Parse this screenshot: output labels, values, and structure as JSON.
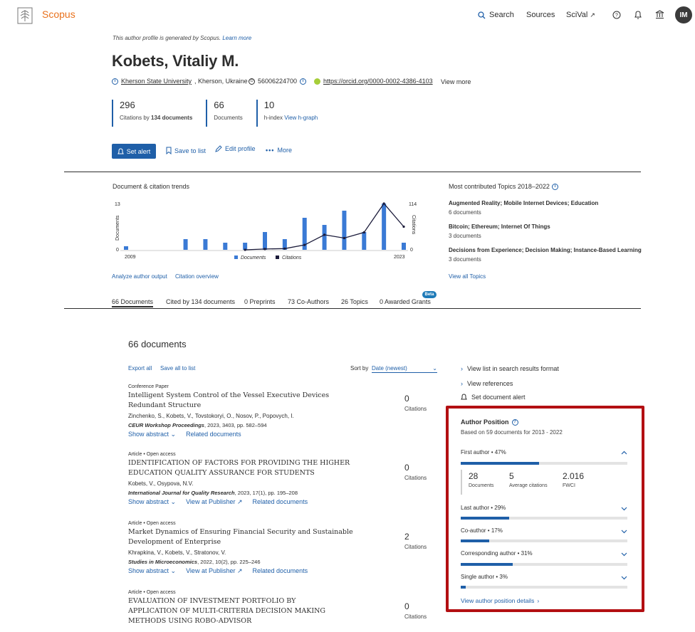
{
  "header": {
    "brand": "Scopus",
    "nav": {
      "search": "Search",
      "sources": "Sources",
      "scival": "SciVal"
    },
    "avatar_initials": "IM"
  },
  "profile": {
    "note": "This author profile is generated by Scopus.",
    "note_link": "Learn more",
    "name": "Kobets, Vitaliy M.",
    "affiliation_link": "Kherson State University",
    "affiliation_rest": ", Kherson, Ukraine",
    "author_id": "56006224700",
    "orcid": "https://orcid.org/0000-0002-4386-4103",
    "view_more": "View more"
  },
  "metrics": {
    "citations": {
      "num": "296",
      "label_pre": "Citations by ",
      "label_bold": "134 documents"
    },
    "documents": {
      "num": "66",
      "label": "Documents"
    },
    "hindex": {
      "num": "10",
      "label": "h-index ",
      "link": "View h-graph"
    }
  },
  "actions": {
    "set_alert": "Set alert",
    "save_to_list": "Save to list",
    "edit_profile": "Edit profile",
    "more": "More"
  },
  "trends": {
    "title": "Document & citation trends",
    "analyze": "Analyze author output",
    "overview": "Citation overview"
  },
  "chart_data": {
    "type": "bar",
    "x_start_label": "2009",
    "x_end_label": "2023",
    "ylabel_left": "Documents",
    "ylabel_right": "Citations",
    "ylim_left": [
      0,
      13
    ],
    "ylim_right": [
      0,
      114
    ],
    "ytick_left": [
      "13",
      "0"
    ],
    "ytick_right": [
      "114",
      "0"
    ],
    "years": [
      2009,
      2010,
      2011,
      2012,
      2013,
      2014,
      2015,
      2016,
      2017,
      2018,
      2019,
      2020,
      2021,
      2022,
      2023
    ],
    "series": [
      {
        "name": "Documents",
        "values": [
          1,
          0,
          0,
          3,
          3,
          2,
          2,
          5,
          3,
          9,
          7,
          11,
          5,
          13,
          2
        ]
      },
      {
        "name": "Citations",
        "values": [
          0,
          0,
          0,
          0,
          0,
          0,
          0,
          2,
          3,
          12,
          37,
          29,
          43,
          114,
          57
        ]
      }
    ]
  },
  "topics": {
    "title": "Most contributed Topics 2018–2022",
    "items": [
      {
        "name": "Augmented Reality; Mobile Internet Devices; Education",
        "count": "6 documents"
      },
      {
        "name": "Bitcoin; Ethereum; Internet Of Things",
        "count": "3 documents"
      },
      {
        "name": "Decisions from Experience; Decision Making; Instance-Based Learning",
        "count": "3 documents"
      }
    ],
    "view_all": "View all Topics"
  },
  "tabs": [
    "66 Documents",
    "Cited by 134 documents",
    "0 Preprints",
    "73 Co-Authors",
    "26 Topics",
    "0 Awarded Grants"
  ],
  "tabs_beta": "Beta",
  "documents": {
    "heading": "66 documents",
    "export_all": "Export all",
    "save_all": "Save all to list",
    "sort_label": "Sort by",
    "sort_value": "Date (newest)",
    "citations_label": "Citations",
    "items": [
      {
        "type": "Conference Paper",
        "title": "Intelligent System Control of the Vessel Executive Devices Redundant Structure",
        "authors": "Zinchenko, S., Kobets, V., Tovstokoryi, O., Nosov, P., Popovych, I.",
        "source_name": "CEUR Workshop Proceedings",
        "source_rest": ", 2023, 3403, pp. 582–594",
        "links": [
          "Show abstract",
          "Related documents"
        ],
        "citations": "0"
      },
      {
        "type": "Article • Open access",
        "title": "IDENTIFICATION OF FACTORS FOR PROVIDING THE HIGHER EDUCATION QUALITY ASSURANCE FOR STUDENTS",
        "authors": "Kobets, V., Osypova, N.V.",
        "source_name": "International Journal for Quality Research",
        "source_rest": ", 2023, 17(1), pp. 195–208",
        "links": [
          "Show abstract",
          "View at Publisher",
          "Related documents"
        ],
        "citations": "0"
      },
      {
        "type": "Article • Open access",
        "title": "Market Dynamics of Ensuring Financial Security and Sustainable Development of Enterprise",
        "authors": "Khrapkina, V., Kobets, V., Stratonov, V.",
        "source_name": "Studies in Microeconomics",
        "source_rest": ", 2022, 10(2), pp. 225–246",
        "links": [
          "Show abstract",
          "View at Publisher",
          "Related documents"
        ],
        "citations": "2"
      },
      {
        "type": "Article • Open access",
        "title": "EVALUATION OF INVESTMENT PORTFOLIO BY APPLICATION OF MULTI-CRITERIA DECISION MAKING METHODS USING ROBO-ADVISOR",
        "authors": "",
        "source_name": "",
        "source_rest": "",
        "links": [],
        "citations": "0"
      }
    ]
  },
  "side_links": {
    "view_list": "View list in search results format",
    "view_refs": "View references",
    "set_doc_alert": "Set document alert"
  },
  "author_position": {
    "title": "Author Position",
    "subtitle": "Based on 59 documents for 2013 - 2022",
    "rows": [
      {
        "label": "First author",
        "pct": "47%",
        "value": 0.47
      },
      {
        "label": "Last author",
        "pct": "29%",
        "value": 0.29
      },
      {
        "label": "Co-author",
        "pct": "17%",
        "value": 0.17
      },
      {
        "label": "Corresponding author",
        "pct": "31%",
        "value": 0.31
      },
      {
        "label": "Single author",
        "pct": "3%",
        "value": 0.03
      }
    ],
    "stats": [
      {
        "num": "28",
        "label": "Documents"
      },
      {
        "num": "5",
        "label": "Average citations"
      },
      {
        "num": "2.016",
        "label": "FWCI"
      }
    ],
    "details_link": "View author position details"
  },
  "colors": {
    "accent": "#1f5fa8",
    "brand": "#e9711c",
    "highlight_border": "#b30f12"
  }
}
